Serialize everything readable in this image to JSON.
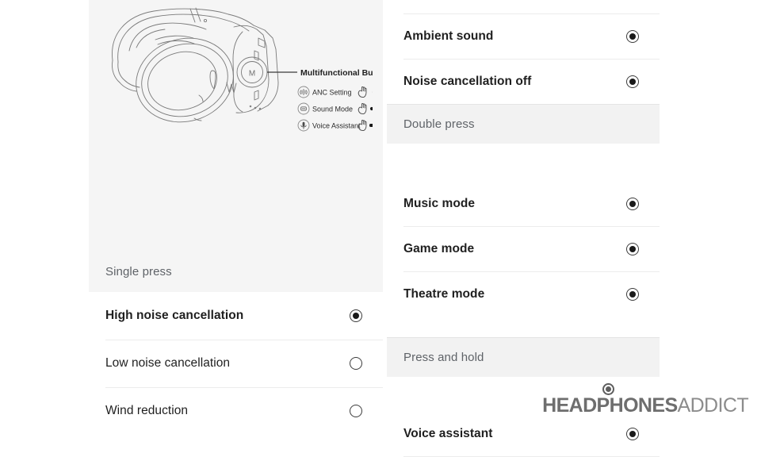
{
  "diagram": {
    "callout_label": "Multifunctional Button",
    "button_glyph": "M",
    "legend": [
      {
        "icon": "anc-waves-icon",
        "label": "ANC Setting",
        "gesture": "single-tap",
        "gesture_icon": "hand-tap-icon"
      },
      {
        "icon": "sound-mode-icon",
        "label": "Sound Mode",
        "gesture": "double-tap",
        "gesture_icon": "hand-tap-icon"
      },
      {
        "icon": "microphone-icon",
        "label": "Voice Assistant",
        "gesture": "press-hold",
        "gesture_icon": "hand-tap-icon"
      }
    ]
  },
  "left": {
    "section_label": "Single press",
    "items": [
      {
        "label": "High noise cancellation",
        "selected": true,
        "bold": true
      },
      {
        "label": "Low noise cancellation",
        "selected": false,
        "bold": false
      },
      {
        "label": "Wind reduction",
        "selected": false,
        "bold": false
      }
    ]
  },
  "right": {
    "top_items": [
      {
        "label": "Ambient sound",
        "selected": true
      },
      {
        "label": "Noise cancellation off",
        "selected": true
      }
    ],
    "section_double_press": "Double press",
    "mode_items": [
      {
        "label": "Music mode",
        "selected": true
      },
      {
        "label": "Game mode",
        "selected": true
      },
      {
        "label": "Theatre mode",
        "selected": true
      }
    ],
    "section_press_hold": "Press and hold",
    "hold_items": [
      {
        "label": "Voice assistant",
        "selected": true
      }
    ]
  },
  "watermark": {
    "strong": "HEADPHONES",
    "light": "ADDICT"
  },
  "colors": {
    "panel_bg": "#f5f5f5",
    "band_bg": "#f2f2f2",
    "divider": "#ececec",
    "text_primary": "#1f1f1f",
    "text_secondary": "#5f6368",
    "radio": "#1a1a1a"
  }
}
